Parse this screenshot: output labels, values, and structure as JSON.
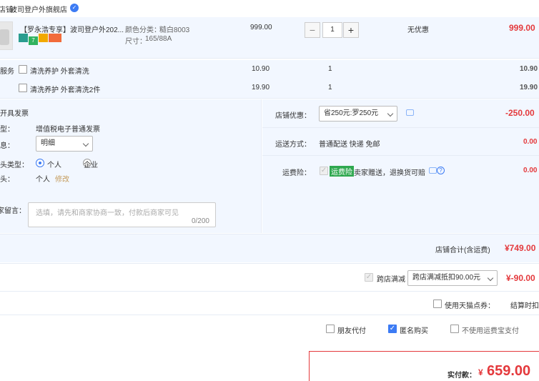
{
  "shop": {
    "label": "店铺：",
    "name": "波司登户外旗舰店",
    "badge": "✓"
  },
  "product": {
    "title": "【罗永浩专享】波司登户外202...",
    "color_label": "颜色分类：",
    "color_value": "糙白8003",
    "size_label": "尺寸：",
    "size_value": "165/88A",
    "price": "999.00",
    "quantity": "1",
    "discount": "无优惠",
    "subtotal": "999.00"
  },
  "services": {
    "label": "服务",
    "items": [
      {
        "name": "清洗养护 外套清洗",
        "price": "10.90",
        "qty": "1",
        "total": "10.90"
      },
      {
        "name": "清洗养护 外套清洗2件",
        "price": "19.90",
        "qty": "1",
        "total": "19.90"
      }
    ]
  },
  "invoice": {
    "heading": "开具发票",
    "type_label": "类型：",
    "type_value": "增值税电子普通发票",
    "info_label": "信息：",
    "info_value": "明细",
    "title_type_label": "抬头类型：",
    "opt_personal": "个人",
    "opt_company": "企业",
    "title_label": "抬头：",
    "title_value": "个人",
    "modify": "修改"
  },
  "message": {
    "label": "家留言：",
    "placeholder": "选填，请先和商家协商一致，付款后商家可见",
    "counter": "0/200"
  },
  "store_discount": {
    "label": "店铺优惠：",
    "value": "省250元:罗250元",
    "amount": "-250.00"
  },
  "shipping": {
    "label": "运送方式：",
    "value": "普通配送 快递 免邮",
    "amount": "0.00"
  },
  "insurance": {
    "label": "运费险：",
    "tag": "运费险",
    "text": "卖家赠送，退换货可赔",
    "amount": "0.00"
  },
  "store_total": {
    "label": "店铺合计(含运费)",
    "amount": "¥749.00"
  },
  "cross_store": {
    "label": "跨店满减",
    "value": "跨店满减抵扣90.00元",
    "amount": "¥-90.00"
  },
  "tmall_points": {
    "label": "使用天猫点券：",
    "extra": "结算时扣"
  },
  "options": {
    "friend_pay": "朋友代付",
    "anonymous": "匿名购买",
    "other": "不使用运费宝支付"
  },
  "pay": {
    "label": "实付款：",
    "currency": "¥",
    "amount": "659.00"
  },
  "colors": {
    "accent": "#3c7bf4",
    "price_red": "#e4393c",
    "panel_bg": "#f2f7ff"
  }
}
